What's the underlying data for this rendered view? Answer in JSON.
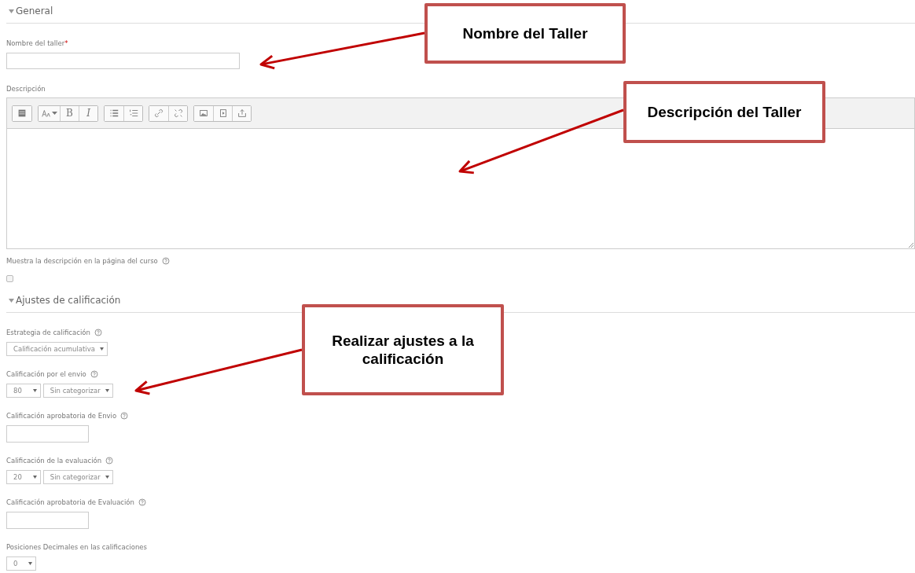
{
  "sections": [
    {
      "title": "General",
      "expanded": true,
      "fields": [
        {
          "kind": "text",
          "label": "Nombre del taller",
          "required_mark": "*"
        },
        {
          "kind": "editor",
          "label": "Descripción",
          "toolbar": [
            [
              {
                "kind": "toolbar-toggle"
              }
            ],
            [
              {
                "kind": "font-size"
              },
              {
                "kind": "bold",
                "label": "B"
              },
              {
                "kind": "italic",
                "label": "I"
              }
            ],
            [
              {
                "kind": "bullet-list"
              },
              {
                "kind": "numbered-list"
              }
            ],
            [
              {
                "kind": "link"
              },
              {
                "kind": "unlink"
              }
            ],
            [
              {
                "kind": "image"
              },
              {
                "kind": "media"
              },
              {
                "kind": "files"
              }
            ]
          ]
        },
        {
          "kind": "checkbox",
          "label": "Muestra la descripción en la página del curso",
          "help": true,
          "checked": false
        }
      ]
    },
    {
      "title": "Ajustes de calificación",
      "expanded": true,
      "fields": [
        {
          "kind": "select",
          "label": "Estrategia de calificación",
          "help": true,
          "selects": [
            {
              "value": "Calificación acumulativa"
            }
          ]
        },
        {
          "kind": "select",
          "label": "Calificación por el envio",
          "help": true,
          "selects": [
            {
              "value": "80"
            },
            {
              "value": "Sin categorizar"
            }
          ]
        },
        {
          "kind": "number",
          "label": "Calificación aprobatoria de Envio",
          "help": true
        },
        {
          "kind": "select",
          "label": "Calificación de la evaluación",
          "help": true,
          "selects": [
            {
              "value": "20"
            },
            {
              "value": "Sin categorizar"
            }
          ]
        },
        {
          "kind": "number",
          "label": "Calificación aprobatoria de Evaluación",
          "help": true
        },
        {
          "kind": "select",
          "label": "Posiciones Decimales en las calificaciones",
          "selects": [
            {
              "value": "0"
            }
          ]
        }
      ]
    }
  ],
  "callouts": [
    {
      "text": "Nombre del Taller"
    },
    {
      "text": "Descripción del Taller"
    },
    {
      "text": "Realizar ajustes a la calificación"
    }
  ]
}
